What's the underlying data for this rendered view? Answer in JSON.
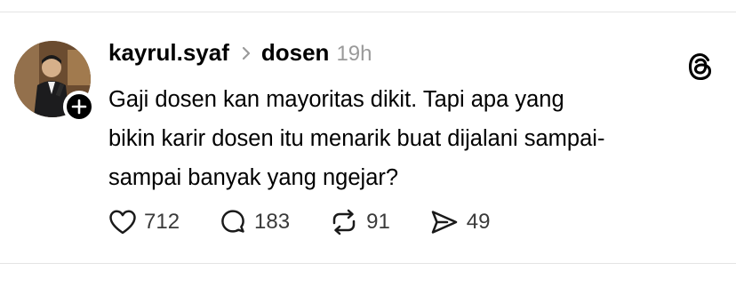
{
  "post": {
    "username": "kayrul.syaf",
    "community": "dosen",
    "time": "19h",
    "text": "Gaji dosen kan mayoritas dikit. Tapi apa yang\nbikin karir dosen itu menarik buat dijalani sampai-\nsampai banyak yang ngejar?"
  },
  "actions": {
    "likes": "712",
    "replies": "183",
    "reposts": "91",
    "shares": "49"
  },
  "icons": {
    "follow": "plus-icon",
    "chevron": "chevron-right-icon",
    "logo": "threads-logo-icon",
    "like": "heart-icon",
    "reply": "comment-icon",
    "repost": "repost-icon",
    "share": "send-icon"
  }
}
